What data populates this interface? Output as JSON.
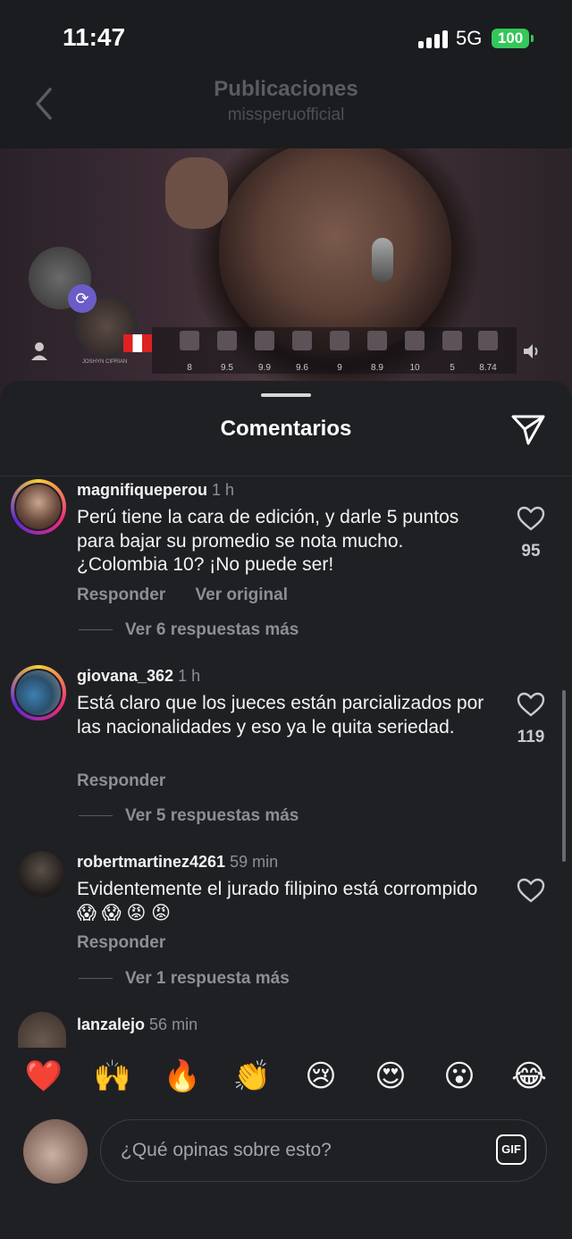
{
  "status": {
    "time": "11:47",
    "network": "5G",
    "battery": "100"
  },
  "header": {
    "title": "Publicaciones",
    "subtitle": "missperuofficial"
  },
  "video": {
    "contestant_label": "JOSHYN CIPRIAN",
    "scores": [
      "8",
      "9.5",
      "9.9",
      "9.6",
      "9",
      "8.9",
      "10",
      "5",
      "8.74"
    ]
  },
  "sheet": {
    "title": "Comentarios"
  },
  "comments": [
    {
      "username": "magnifiqueperou",
      "time": "1 h",
      "text": "Perú tiene la cara de edición, y darle 5 puntos para bajar su promedio se nota mucho. ¿Colombia 10? ¡No puede ser!",
      "likes": "95",
      "reply_label": "Responder",
      "original_label": "Ver original",
      "more_replies": "Ver 6 respuestas más"
    },
    {
      "username": "giovana_362",
      "time": "1 h",
      "text": "Está claro que los jueces están parcializados por las nacionalidades y eso ya le quita seriedad.",
      "likes": "119",
      "reply_label": "Responder",
      "more_replies": "Ver 5 respuestas más"
    },
    {
      "username": "robertmartinez4261",
      "time": "59 min",
      "text": "Evidentemente el jurado filipino está corrompido 😱 😱 😡 😡",
      "reply_label": "Responder",
      "more_replies": "Ver 1 respuesta más"
    },
    {
      "username": "lanzalejo",
      "time": "56 min"
    }
  ],
  "quick_reactions": [
    "❤️",
    "🙌",
    "🔥",
    "👏",
    "😢",
    "😍",
    "😮",
    "😂"
  ],
  "composer": {
    "placeholder": "¿Qué opinas sobre esto?",
    "gif_label": "GIF"
  },
  "icons": {
    "back": "chevron-left-icon",
    "share": "paper-plane-icon",
    "like": "heart-outline-icon",
    "sound": "speaker-icon",
    "user": "user-icon",
    "repost": "sync-icon"
  }
}
